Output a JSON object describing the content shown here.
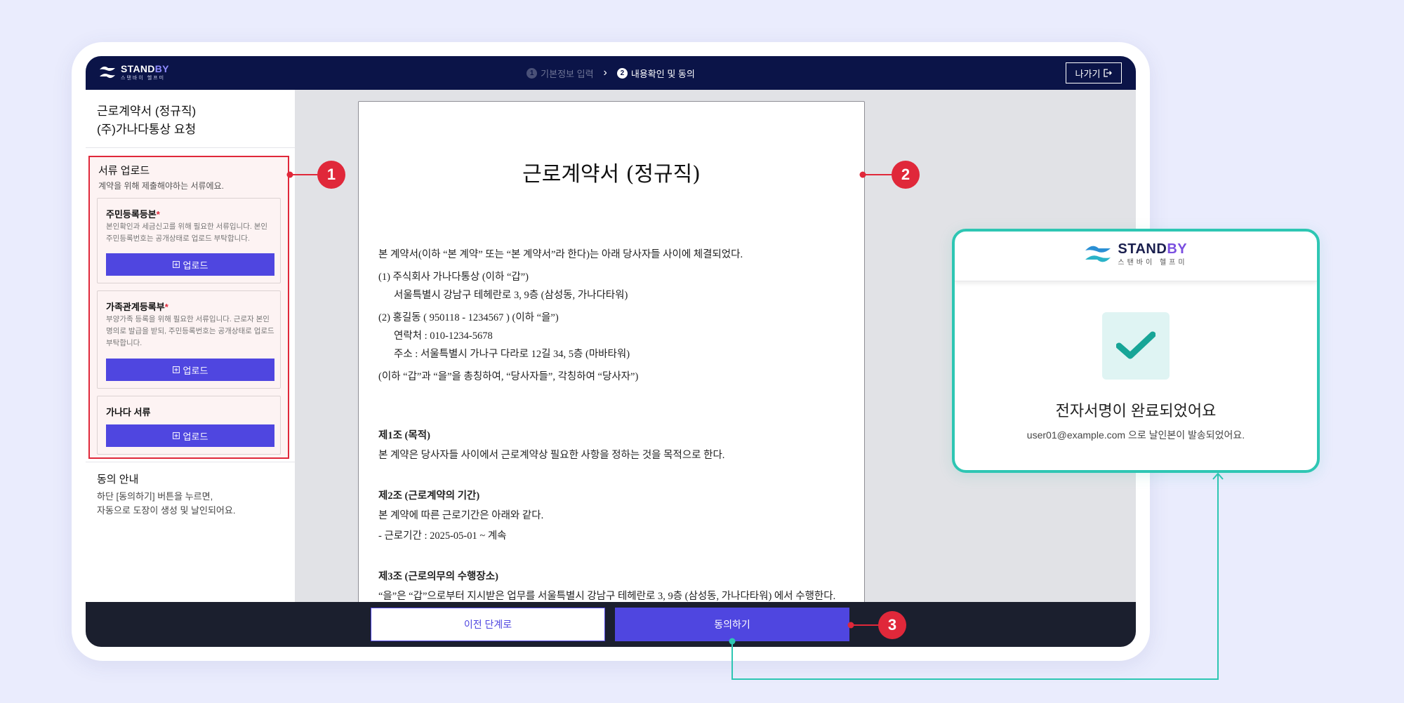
{
  "header": {
    "logo_text_stand": "STAND",
    "logo_text_by": "BY",
    "logo_sub": "스탠바이 헬프미",
    "steps": [
      {
        "num": "1",
        "label": "기본정보 입력"
      },
      {
        "num": "2",
        "label": "내용확인 및 동의"
      }
    ],
    "step_separator": "›",
    "exit_label": "나가기"
  },
  "sidebar": {
    "title_line1": "근로계약서 (정규직)",
    "title_line2": "(주)가나다통상 요청",
    "upload_section": {
      "title": "서류 업로드",
      "desc": "계약을 위해 제출해야하는 서류에요.",
      "documents": [
        {
          "name": "주민등록등본",
          "required_mark": "*",
          "desc": "본인확인과 세금신고를 위해 필요한 서류입니다. 본인 주민등록번호는 공개상태로 업로드 부탁합니다.",
          "button_label": "업로드"
        },
        {
          "name": "가족관계등록부",
          "required_mark": "*",
          "desc": "부양가족 등록을 위해 필요한 서류입니다. 근로자 본인 명의로 발급을 받되, 주민등록번호는 공개상태로 업로드 부탁합니다.",
          "button_label": "업로드"
        },
        {
          "name": "가나다 서류",
          "required_mark": "",
          "desc": "",
          "button_label": "업로드"
        }
      ]
    },
    "agree_section": {
      "title": "동의 안내",
      "line1": "하단 [동의하기] 버튼을 누르면,",
      "line2": "자동으로 도장이 생성 및 날인되어요."
    }
  },
  "document": {
    "title": "근로계약서 (정규직)",
    "intro": "본 계약서(이하 “본 계약” 또는 “본 계약서”라 한다)는 아래 당사자들 사이에 체결되었다.",
    "party1_line": "(1) 주식회사 가나다통상 (이하 “갑”)",
    "party1_addr": "서울특별시 강남구 테헤란로 3, 9층 (삼성동, 가나다타워)",
    "party2_line": "(2)  홍길동 ( 950118 - 1234567 ) (이하 “을”)",
    "party2_phone": "연락처 : 010-1234-5678",
    "party2_addr": "주소 : 서울특별시 가나구 다라로 12길 34, 5층 (마바타워)",
    "parties_note": "(이하 “갑”과 “을”을 총칭하여, “당사자들”, 각칭하여 “당사자”)",
    "art1_title": "제1조 (목적)",
    "art1_body": "본 계약은 당사자들 사이에서 근로계약상 필요한 사항을 정하는 것을 목적으로 한다.",
    "art2_title": "제2조 (근로계약의 기간)",
    "art2_body": "본 계약에 따른 근로기간은 아래와 같다.",
    "art2_item": "- 근로기간 :  2025-05-01  ~  계속",
    "art3_title": "제3조 (근로의무의 수행장소)",
    "art3_body": "“을”은 “갑”으로부터 지시받은 업무를 서울특별시 강남구 테헤란로 3, 9층 (삼성동, 가나다타워) 에서 수행한다."
  },
  "footer": {
    "prev_label": "이전 단계로",
    "agree_label": "동의하기"
  },
  "callouts": [
    "1",
    "2",
    "3"
  ],
  "completion_card": {
    "logo_text_stand": "STAND",
    "logo_text_by": "BY",
    "logo_sub": "스탠바이 헬프미",
    "title": "전자서명이 완료되었어요",
    "message": "user01@example.com 으로 날인본이 발송되었어요."
  },
  "colors": {
    "navy": "#0b1448",
    "primary": "#4f46e0",
    "highlight_red": "#e0283a",
    "teal": "#2ec6b3"
  }
}
